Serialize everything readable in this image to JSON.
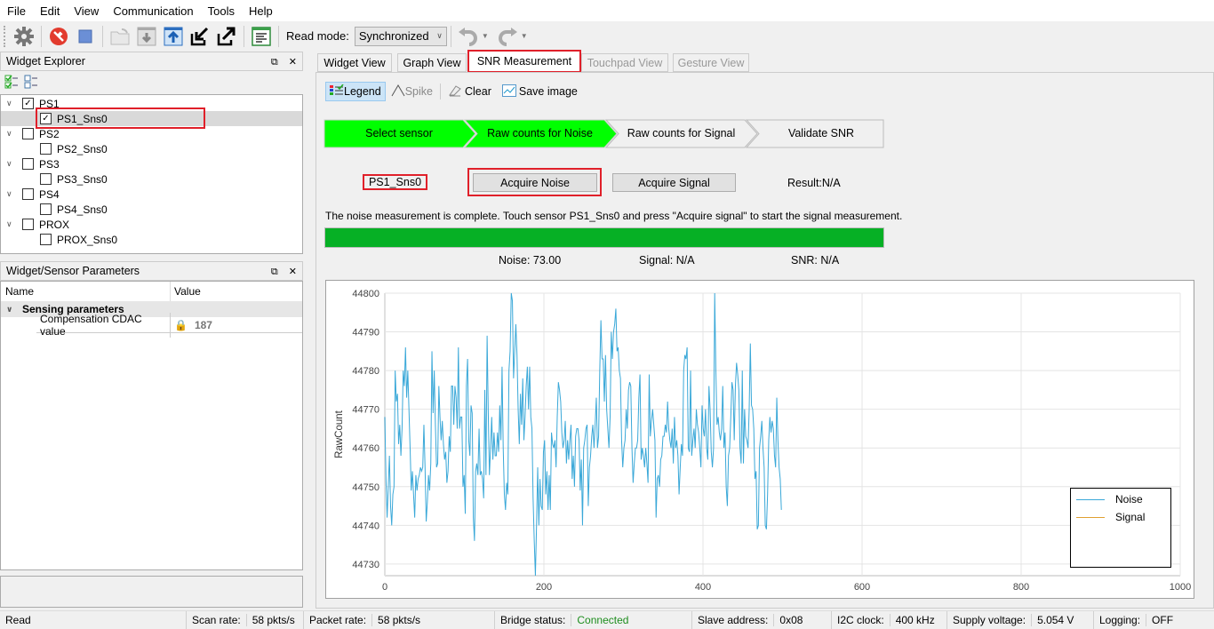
{
  "menu": [
    "File",
    "Edit",
    "View",
    "Communication",
    "Tools",
    "Help"
  ],
  "toolbar": {
    "icons": [
      "gear-icon",
      "disconnect-icon",
      "stop-icon",
      "open-folder-icon",
      "download-icon",
      "upload-icon",
      "import-icon",
      "export-icon",
      "log-icon"
    ],
    "read_mode_label": "Read mode:",
    "read_mode_value": "Synchronized"
  },
  "widget_explorer": {
    "title": "Widget Explorer",
    "items": [
      {
        "label": "PS1",
        "checked": true,
        "children": [
          {
            "label": "PS1_Sns0",
            "checked": true,
            "selected": true
          }
        ]
      },
      {
        "label": "PS2",
        "checked": false,
        "children": [
          {
            "label": "PS2_Sns0",
            "checked": false
          }
        ]
      },
      {
        "label": "PS3",
        "checked": false,
        "children": [
          {
            "label": "PS3_Sns0",
            "checked": false
          }
        ]
      },
      {
        "label": "PS4",
        "checked": false,
        "children": [
          {
            "label": "PS4_Sns0",
            "checked": false
          }
        ]
      },
      {
        "label": "PROX",
        "checked": false,
        "children": [
          {
            "label": "PROX_Sns0",
            "checked": false
          }
        ]
      }
    ]
  },
  "parameters": {
    "title": "Widget/Sensor Parameters",
    "col_name": "Name",
    "col_value": "Value",
    "group": "Sensing parameters",
    "rows": [
      {
        "name": "Compensation CDAC value",
        "value": "187",
        "locked": true
      }
    ]
  },
  "tabs": [
    {
      "label": "Widget View",
      "state": "normal"
    },
    {
      "label": "Graph View",
      "state": "normal"
    },
    {
      "label": "SNR Measurement",
      "state": "active"
    },
    {
      "label": "Touchpad View",
      "state": "disabled"
    },
    {
      "label": "Gesture View",
      "state": "disabled"
    }
  ],
  "snr_toolbar": {
    "legend": "Legend",
    "spike": "Spike",
    "clear": "Clear",
    "save_image": "Save image"
  },
  "steps": [
    {
      "label": "Select sensor",
      "done": true
    },
    {
      "label": "Raw counts for Noise",
      "done": true
    },
    {
      "label": "Raw counts for Signal",
      "done": false
    },
    {
      "label": "Validate SNR",
      "done": false
    }
  ],
  "sensor_name": "PS1_Sns0",
  "acquire_noise": "Acquire Noise",
  "acquire_signal": "Acquire Signal",
  "result": "Result:N/A",
  "message": "The noise measurement is complete. Touch sensor PS1_Sns0 and press \"Acquire signal\" to start the signal measurement.",
  "progress": 1.0,
  "metrics": {
    "noise": "Noise:  73.00",
    "signal": "Signal:  N/A",
    "snr": "SNR:  N/A"
  },
  "colors": {
    "step_done": "#00ff00",
    "progress": "#06b025",
    "noise_line": "#3aa8d8",
    "signal_line": "#e0a030",
    "highlight": "#e0202a"
  },
  "chart_data": {
    "type": "line",
    "title": "",
    "xlabel": "",
    "ylabel": "RawCount",
    "xlim": [
      0,
      1000
    ],
    "ylim": [
      44727,
      44800
    ],
    "xticks": [
      0,
      200,
      400,
      600,
      800,
      1000
    ],
    "yticks": [
      44730,
      44740,
      44750,
      44760,
      44770,
      44780,
      44790,
      44800
    ],
    "grid": true,
    "legend": "bottom-right",
    "series": [
      {
        "name": "Noise",
        "color": "#3aa8d8",
        "x_step": 2,
        "values": [
          44768,
          44752,
          44742,
          44750,
          44758,
          44745,
          44740,
          44748,
          44750,
          44780,
          44772,
          44774,
          44761,
          44766,
          44758,
          44765,
          44780,
          44776,
          44786,
          44773,
          44780,
          44770,
          44760,
          44749,
          44754,
          44748,
          44742,
          44753,
          44749,
          44752,
          44753,
          44755,
          44754,
          44755,
          44766,
          44755,
          44741,
          44746,
          44753,
          44749,
          44756,
          44785,
          44769,
          44780,
          44766,
          44755,
          44756,
          44776,
          44768,
          44762,
          44767,
          44761,
          44757,
          44759,
          44751,
          44754,
          44763,
          44759,
          44776,
          44776,
          44766,
          44776,
          44773,
          44765,
          44786,
          44765,
          44768,
          44768,
          44750,
          44753,
          44743,
          44776,
          44783,
          44762,
          44758,
          44771,
          44769,
          44742,
          44736,
          44754,
          44756,
          44753,
          44765,
          44753,
          44754,
          44752,
          44747,
          44775,
          44753,
          44789,
          44769,
          44753,
          44760,
          44768,
          44757,
          44764,
          44758,
          44758,
          44764,
          44759,
          44771,
          44762,
          44781,
          44760,
          44748,
          44744,
          44751,
          44748,
          44780,
          44785,
          44800,
          44798,
          44778,
          44785,
          44792,
          44784,
          44770,
          44761,
          44774,
          44766,
          44778,
          44762,
          44768,
          44776,
          44781,
          44770,
          44781,
          44768,
          44765,
          44747,
          44736,
          44727,
          44740,
          44755,
          44740,
          44752,
          44745,
          44744,
          44759,
          44762,
          44748,
          44754,
          44744,
          44753,
          44744,
          44764,
          44761,
          44760,
          44762,
          44755,
          44768,
          44777,
          44775,
          44772,
          44764,
          44760,
          44762,
          44767,
          44756,
          44762,
          44757,
          44762,
          44766,
          44752,
          44758,
          44750,
          44763,
          44765,
          44765,
          44762,
          44749,
          44757,
          44740,
          44760,
          44762,
          44765,
          44766,
          44745,
          44755,
          44758,
          44763,
          44766,
          44760,
          44766,
          44773,
          44760,
          44763,
          44780,
          44793,
          44783,
          44783,
          44772,
          44784,
          44770,
          44765,
          44760,
          44768,
          44790,
          44783,
          44790,
          44792,
          44796,
          44785,
          44786,
          44780,
          44778,
          44762,
          44755,
          44760,
          44762,
          44770,
          44765,
          44775,
          44777,
          44776,
          44760,
          44751,
          44756,
          44760,
          44760,
          44762,
          44773,
          44779,
          44757,
          44760,
          44758,
          44755,
          44760,
          44756,
          44751,
          44779,
          44763,
          44767,
          44770,
          44766,
          44762,
          44742,
          44752,
          44753,
          44750,
          44757,
          44758,
          44763,
          44763,
          44766,
          44764,
          44772,
          44765,
          44762,
          44760,
          44765,
          44756,
          44768,
          44760,
          44762,
          44758,
          44748,
          44755,
          44761,
          44758,
          44780,
          44784,
          44783,
          44786,
          44760,
          44759,
          44780,
          44758,
          44762,
          44765,
          44760,
          44770,
          44766,
          44764,
          44760,
          44755,
          44771,
          44765,
          44763,
          44770,
          44760,
          44757,
          44776,
          44770,
          44759,
          44755,
          44760,
          44800,
          44780,
          44766,
          44768,
          44764,
          44762,
          44765,
          44776,
          44760,
          44764,
          44750,
          44745,
          44758,
          44760,
          44768,
          44777,
          44775,
          44762,
          44776,
          44782,
          44779,
          44775,
          44760,
          44756,
          44780,
          44756,
          44770,
          44763,
          44762,
          44760,
          44770,
          44787,
          44771,
          44770,
          44765,
          44752,
          44754,
          44739,
          44740,
          44760,
          44763,
          44767,
          44760,
          44755,
          44740,
          44739,
          44748,
          44762,
          44768,
          44764,
          44767,
          44765,
          44758,
          44755,
          44773,
          44762,
          44755,
          44752,
          44744
        ]
      },
      {
        "name": "Signal",
        "color": "#e0a030",
        "values": []
      }
    ]
  },
  "statusbar": {
    "left": "Read",
    "scan_rate_label": "Scan rate:",
    "scan_rate": "58 pkts/s",
    "packet_rate_label": "Packet rate:",
    "packet_rate": "58 pkts/s",
    "bridge_label": "Bridge status:",
    "bridge": "Connected",
    "slave_label": "Slave address:",
    "slave": "0x08",
    "i2c_label": "I2C clock:",
    "i2c": "400 kHz",
    "supply_label": "Supply voltage:",
    "supply": "5.054 V",
    "logging_label": "Logging:",
    "logging": "OFF"
  }
}
